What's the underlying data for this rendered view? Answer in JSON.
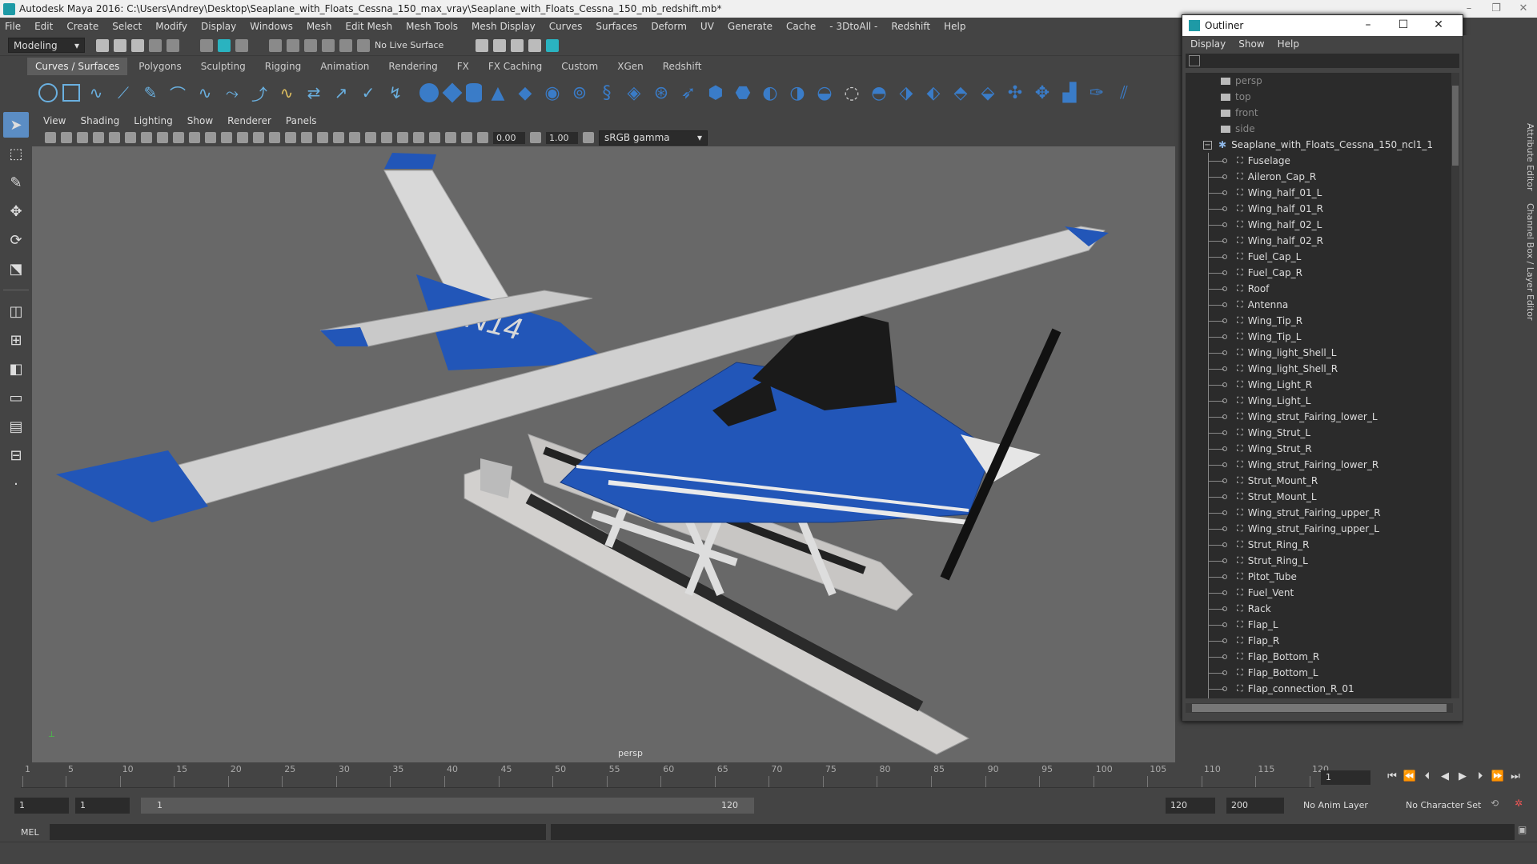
{
  "window": {
    "title": "Autodesk Maya 2016: C:\\Users\\Andrey\\Desktop\\Seaplane_with_Floats_Cessna_150_max_vray\\Seaplane_with_Floats_Cessna_150_mb_redshift.mb*"
  },
  "menubar": [
    "File",
    "Edit",
    "Create",
    "Select",
    "Modify",
    "Display",
    "Windows",
    "Mesh",
    "Edit Mesh",
    "Mesh Tools",
    "Mesh Display",
    "Curves",
    "Surfaces",
    "Deform",
    "UV",
    "Generate",
    "Cache",
    "- 3DtoAll -",
    "Redshift",
    "Help"
  ],
  "statusline": {
    "mode": "Modeling",
    "live_surface": "No Live Surface"
  },
  "shelf_tabs": [
    "Curves / Surfaces",
    "Polygons",
    "Sculpting",
    "Rigging",
    "Animation",
    "Rendering",
    "FX",
    "FX Caching",
    "Custom",
    "XGen",
    "Redshift"
  ],
  "viewport": {
    "menus": [
      "View",
      "Shading",
      "Lighting",
      "Show",
      "Renderer",
      "Panels"
    ],
    "exposure": "0.00",
    "gamma": "1.00",
    "color_space": "sRGB gamma",
    "camera_label": "persp",
    "tail_number": "N14"
  },
  "outliner": {
    "title": "Outliner",
    "menus": [
      "Display",
      "Show",
      "Help"
    ],
    "cameras": [
      "persp",
      "top",
      "front",
      "side"
    ],
    "root": "Seaplane_with_Floats_Cessna_150_ncl1_1",
    "children": [
      "Fuselage",
      "Aileron_Cap_R",
      "Wing_half_01_L",
      "Wing_half_01_R",
      "Wing_half_02_L",
      "Wing_half_02_R",
      "Fuel_Cap_L",
      "Fuel_Cap_R",
      "Roof",
      "Antenna",
      "Wing_Tip_R",
      "Wing_Tip_L",
      "Wing_light_Shell_L",
      "Wing_light_Shell_R",
      "Wing_Light_R",
      "Wing_Light_L",
      "Wing_strut_Fairing_lower_L",
      "Wing_Strut_L",
      "Wing_Strut_R",
      "Wing_strut_Fairing_lower_R",
      "Strut_Mount_R",
      "Strut_Mount_L",
      "Wing_strut_Fairing_upper_R",
      "Wing_strut_Fairing_upper_L",
      "Strut_Ring_R",
      "Strut_Ring_L",
      "Pitot_Tube",
      "Fuel_Vent",
      "Rack",
      "Flap_L",
      "Flap_R",
      "Flap_Bottom_R",
      "Flap_Bottom_L",
      "Flap_connection_R_01"
    ]
  },
  "right_tabs": [
    "Attribute Editor",
    "Channel Box / Layer Editor"
  ],
  "timeline": {
    "ticks": [
      1,
      5,
      10,
      15,
      20,
      25,
      30,
      35,
      40,
      45,
      50,
      55,
      60,
      65,
      70,
      75,
      80,
      85,
      90,
      95,
      100,
      105,
      110,
      115,
      120
    ],
    "current_frame": "1"
  },
  "range": {
    "start": "1",
    "start2": "1",
    "slider_start": "1",
    "slider_end": "120",
    "end": "120",
    "anim_end": "200",
    "anim_layer": "No Anim Layer",
    "character_set": "No Character Set"
  },
  "command_line": {
    "label": "MEL"
  }
}
